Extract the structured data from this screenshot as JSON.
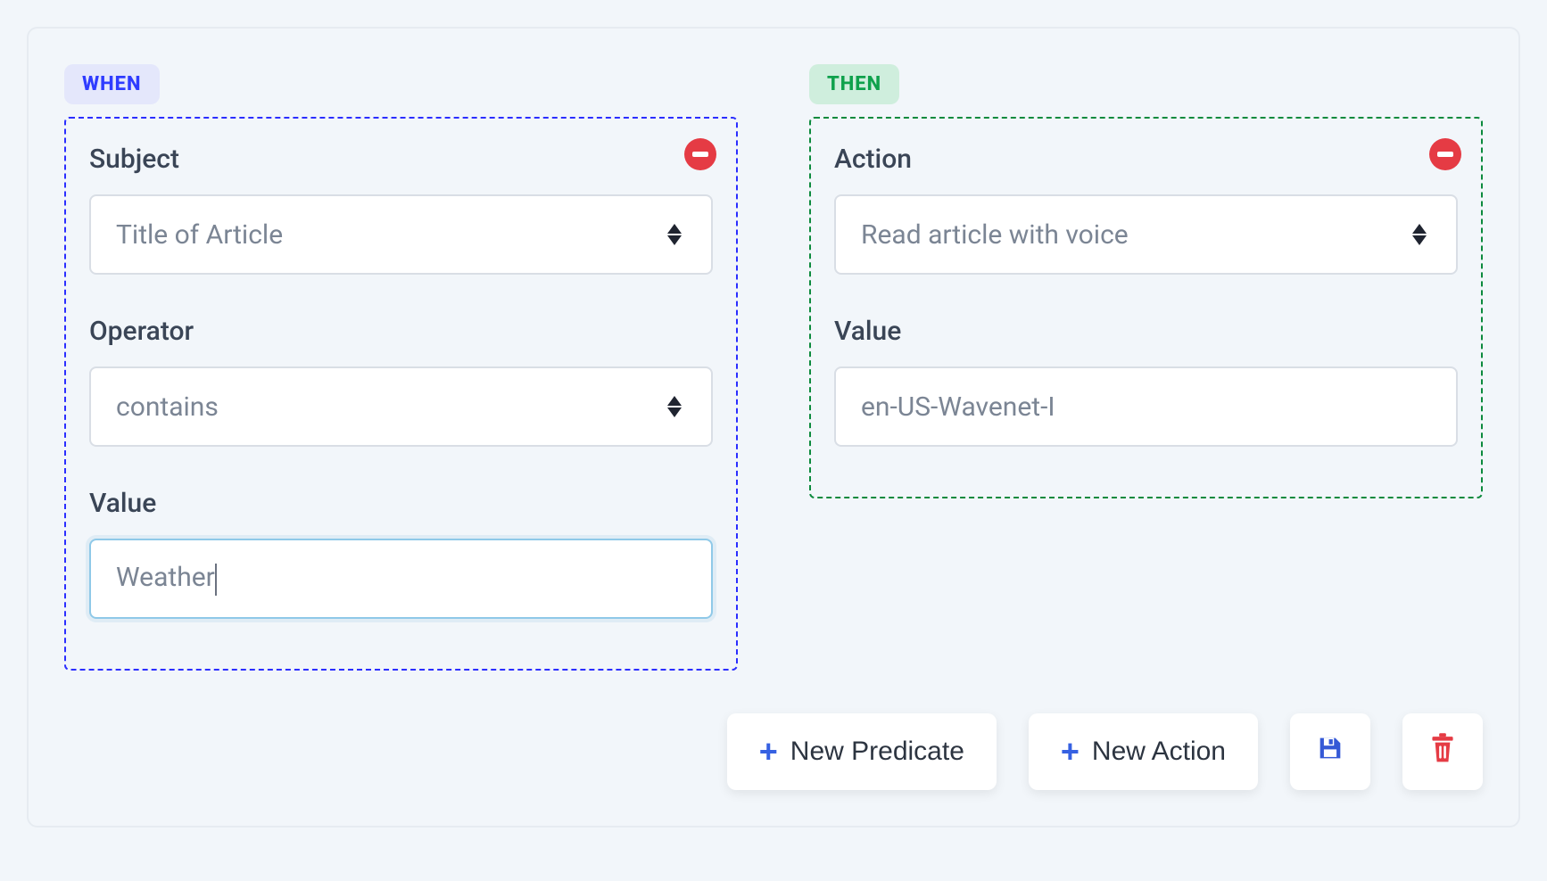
{
  "tags": {
    "when": "WHEN",
    "then": "THEN"
  },
  "when_panel": {
    "subject": {
      "label": "Subject",
      "value": "Title of Article"
    },
    "operator": {
      "label": "Operator",
      "value": "contains"
    },
    "value": {
      "label": "Value",
      "value": "Weather"
    }
  },
  "then_panel": {
    "action": {
      "label": "Action",
      "value": "Read article with voice"
    },
    "value": {
      "label": "Value",
      "value": "en-US-Wavenet-I"
    }
  },
  "buttons": {
    "new_predicate": "New Predicate",
    "new_action": "New Action"
  }
}
